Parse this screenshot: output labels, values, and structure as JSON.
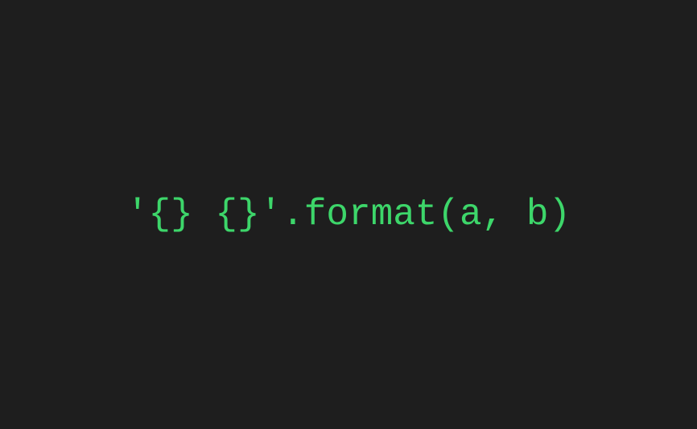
{
  "code": {
    "text": "'{} {}'.format(a, b)"
  }
}
